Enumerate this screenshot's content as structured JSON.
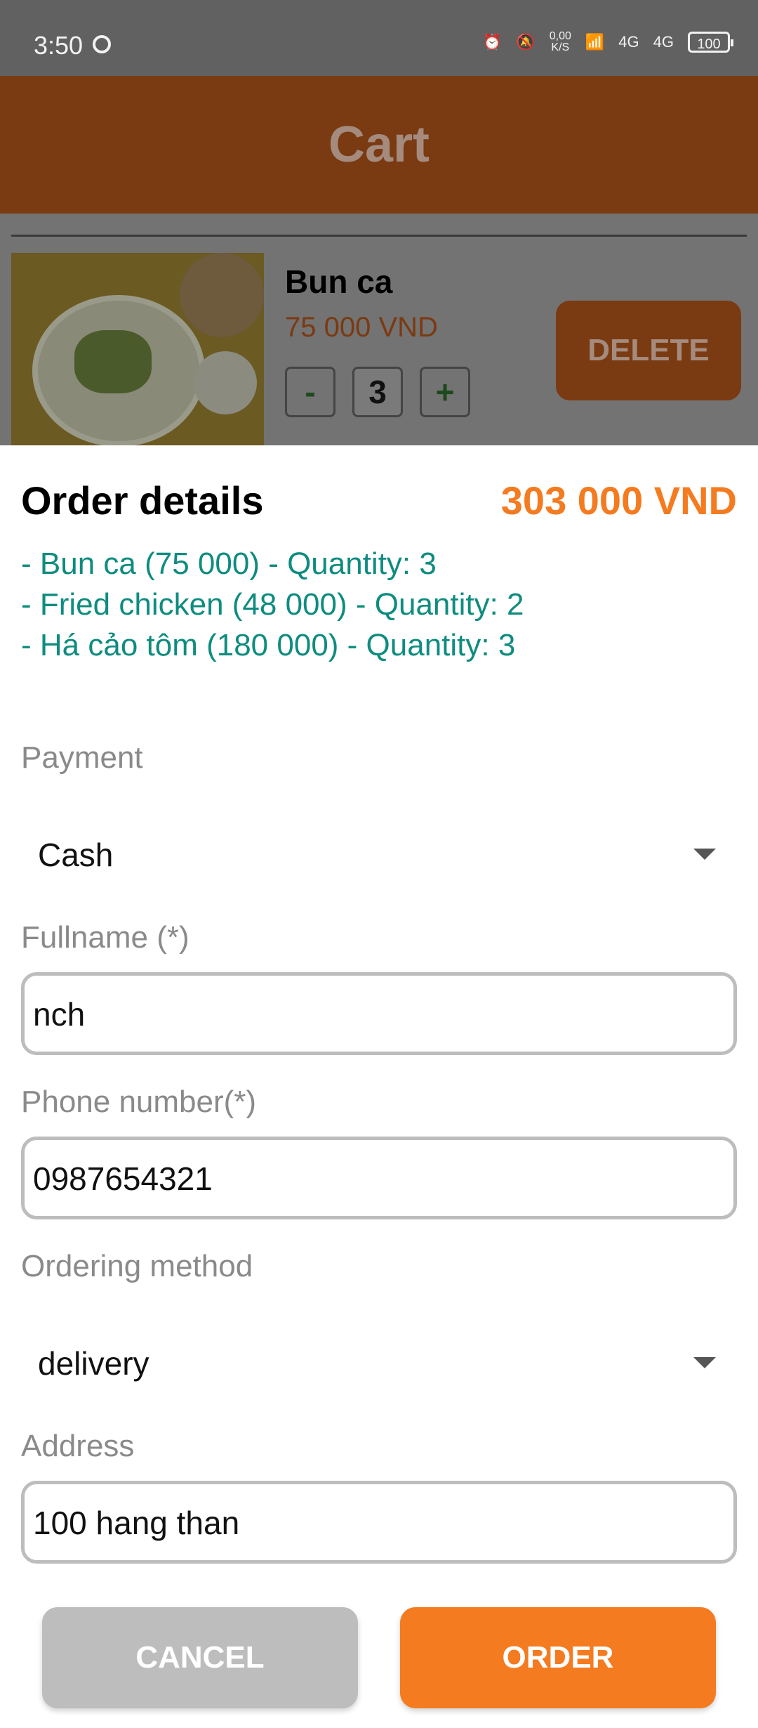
{
  "status_bar": {
    "time": "3:50",
    "net_speed": "0,00",
    "net_unit": "K/S",
    "signal1": "4G",
    "signal2": "4G",
    "battery": "100"
  },
  "header": {
    "title": "Cart"
  },
  "cart_item": {
    "name": "Bun ca",
    "price": "75 000 VND",
    "qty_minus": "-",
    "qty_value": "3",
    "qty_plus": "+",
    "delete_label": "DELETE"
  },
  "order_details": {
    "title": "Order details",
    "total": "303 000 VND",
    "lines": [
      "- Bun ca (75 000) - Quantity: 3",
      "- Fried chicken (48 000) - Quantity: 2",
      "- Há cảo tôm (180 000) - Quantity: 3"
    ]
  },
  "form": {
    "payment_label": "Payment",
    "payment_value": "Cash",
    "fullname_label": "Fullname (*)",
    "fullname_value": "nch",
    "phone_label": "Phone number(*)",
    "phone_value": "0987654321",
    "method_label": "Ordering method",
    "method_value": "delivery",
    "address_label": "Address",
    "address_value": "100 hang than"
  },
  "buttons": {
    "cancel": "CANCEL",
    "order": "ORDER"
  },
  "colors": {
    "accent": "#f47b20",
    "teal_text": "#0e8c7f",
    "header_dim": "#7a3a12"
  }
}
